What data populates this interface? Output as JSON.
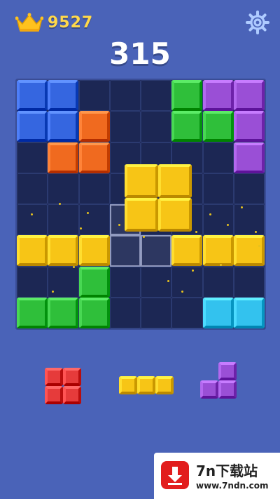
{
  "header": {
    "best_score": "9527",
    "score": "315",
    "crown_icon": "crown-icon",
    "settings_icon": "gear-icon"
  },
  "colors": {
    "background": "#4a63b8",
    "board": "#1c2754",
    "blue": "#3566e0",
    "green": "#2fbf3a",
    "purple": "#9a4fd6",
    "orange": "#f06a1f",
    "yellow": "#f7c516",
    "cyan": "#33c2ee",
    "red": "#e63b3b"
  },
  "board": {
    "rows": 8,
    "cols": 8,
    "cells": [
      [
        "blue",
        "blue",
        "",
        "",
        "",
        "green",
        "purple",
        "purple"
      ],
      [
        "blue",
        "blue",
        "orange",
        "",
        "",
        "green",
        "green",
        "purple"
      ],
      [
        "",
        "orange",
        "orange",
        "",
        "",
        "",
        "",
        "purple"
      ],
      [
        "",
        "",
        "",
        "",
        "",
        "",
        "",
        ""
      ],
      [
        "",
        "",
        "",
        "",
        "",
        "",
        "",
        ""
      ],
      [
        "yellow",
        "yellow",
        "yellow",
        "",
        "",
        "yellow",
        "yellow",
        "yellow"
      ],
      [
        "",
        "",
        "green",
        "",
        "",
        "",
        "",
        ""
      ],
      [
        "green",
        "green",
        "green",
        "",
        "",
        "",
        "cyan",
        "cyan"
      ]
    ],
    "dragging_piece": {
      "color": "yellow",
      "shape": [
        [
          1,
          1
        ],
        [
          1,
          1
        ]
      ]
    },
    "drop_target": [
      [
        4,
        3
      ],
      [
        5,
        3
      ],
      [
        5,
        4
      ]
    ]
  },
  "tray": [
    {
      "color": "red",
      "shape": [
        [
          1,
          1
        ],
        [
          1,
          1
        ]
      ]
    },
    {
      "color": "yellow",
      "shape": [
        [
          1,
          1,
          1
        ]
      ]
    },
    {
      "color": "purple",
      "shape": [
        [
          0,
          1
        ],
        [
          1,
          1
        ]
      ]
    }
  ],
  "watermark": {
    "title": "7n下载站",
    "url": "www.7ndn.com",
    "icon": "download-arrow-icon"
  }
}
